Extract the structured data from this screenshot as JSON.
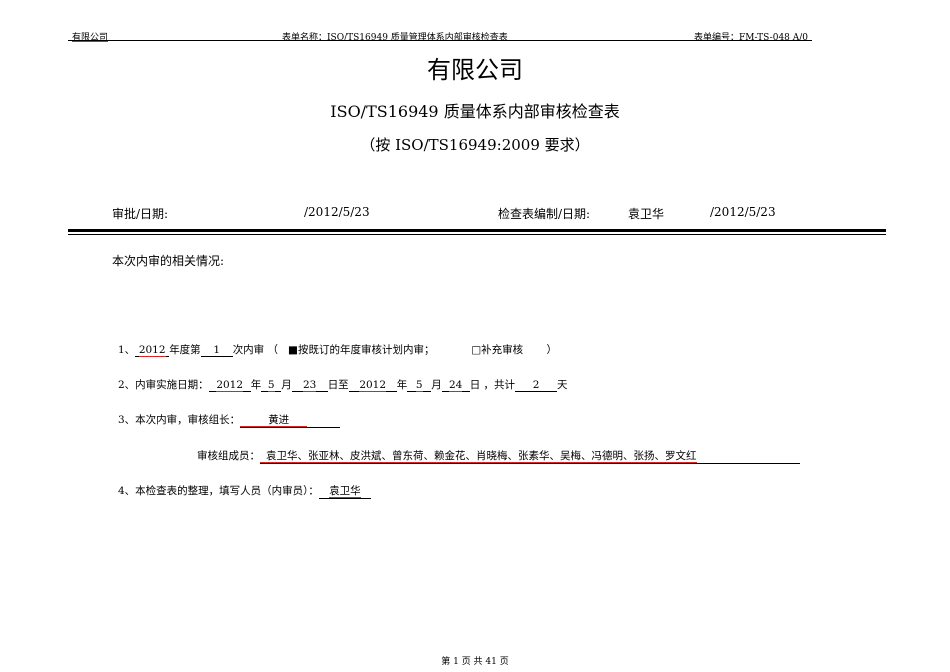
{
  "header": {
    "company": "有限公司",
    "form_name": "表单名称：ISO/TS16949 质量管理体系内部审核检查表",
    "form_no": "表单编号：FM-TS-048 A/0"
  },
  "title": {
    "company": "有限公司",
    "main": "ISO/TS16949 质量体系内部审核检查表",
    "sub": "（按 ISO/TS16949:2009 要求）"
  },
  "approval": {
    "approve_label": "审批/日期:",
    "approve_date": "/2012/5/23",
    "compile_label": "检查表编制/日期:",
    "compiler": "袁卫华",
    "compile_date": "/2012/5/23"
  },
  "section_title": "本次内审的相关情况:",
  "item1": {
    "prefix": "1、",
    "year": "2012",
    "t1": "年度第",
    "count": "1",
    "t2": "次内审 （",
    "opt1_box": "■",
    "opt1": "按既订的年度审核计划内审；",
    "opt2_box": "□",
    "opt2": "补充审核",
    "close": "）"
  },
  "item2": {
    "prefix": "2、内审实施日期：",
    "y1": "2012",
    "t_year": "年",
    "m1": "5",
    "t_month": "月",
    "d1": "23",
    "t_to": "日至",
    "y2": "2012",
    "m2": "5",
    "d2": "24",
    "t_day": "日 ，共计",
    "days": "2",
    "t_unit": "天"
  },
  "item3": {
    "label": "3、本次内审，审核组长：",
    "leader": "黄进",
    "members_label": "审核组成员：",
    "members": "袁卫华、张亚林、皮洪斌、曾东荷、赖金花、肖晓梅、张素华、吴梅、冯德明、张扬、罗文红"
  },
  "item4": {
    "label": "4、本检查表的整理，填写人员（内审员）：",
    "filler": "袁卫华"
  },
  "footer": "第 1 页 共 41 页"
}
